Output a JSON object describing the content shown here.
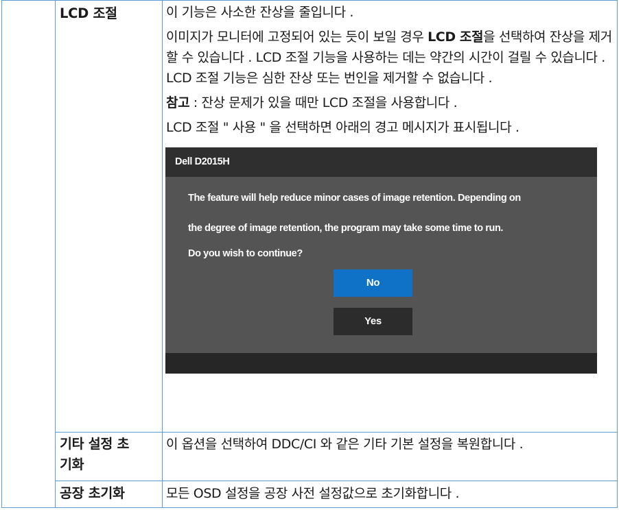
{
  "rows": [
    {
      "label": "LCD 조절",
      "p1": "이 기능은 사소한 잔상을 줄입니다 .",
      "p2_before": "이미지가 모니터에 고정되어 있는 듯이 보일 경우 ",
      "p2_bold": "LCD 조절",
      "p2_after": "을 선택하여 잔상을 제거할 수 있습니다 . LCD 조절 기능을 사용하는 데는 약간의 시간이 걸릴 수 있습니다 . LCD 조절 기능은 심한 잔상 또는 번인을 제거할 수 없습니다 .",
      "note_bold": "참고",
      "note_text": " : 잔상 문제가 있을 때만 LCD 조절을 사용합니다 .",
      "p4": "LCD 조절 \" 사용 \" 을 선택하면 아래의 경고 메시지가 표시됩니다 ."
    },
    {
      "label": "기타 설정 초기화",
      "text": "이 옵션을 선택하여 DDC/CI 와 같은 기타 기본 설정을 복원합니다 ."
    },
    {
      "label": "공장 초기화",
      "text": "모든 OSD 설정을 공장 사전 설정값으로 초기화합니다 ."
    }
  ],
  "dialog": {
    "title": "Dell D2015H",
    "message_lines": [
      "The feature will help reduce minor cases of image retention. Depending on",
      "the degree of image retention, the program may take some time to run.",
      "Do you wish to continue?"
    ],
    "no_label": "No",
    "yes_label": "Yes",
    "selected_button": "No",
    "colors": {
      "panel": "#545454",
      "titlebar": "#2f2f2f",
      "selected_button": "#0f72c6",
      "button": "#2c2c2c",
      "footer": "#262626"
    }
  },
  "border_color": "#5b9bd5"
}
